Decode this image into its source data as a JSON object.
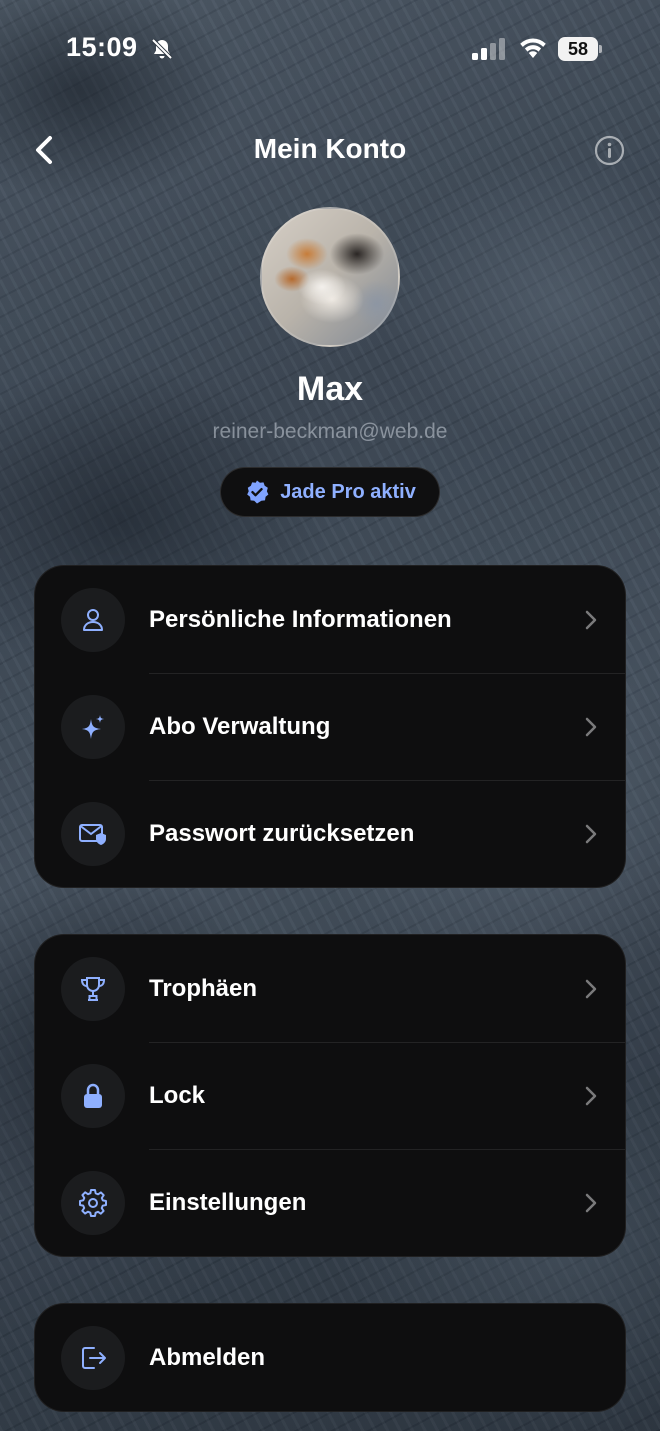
{
  "status_bar": {
    "time": "15:09",
    "battery": "58"
  },
  "nav": {
    "title": "Mein Konto"
  },
  "profile": {
    "name": "Max",
    "email": "reiner-beckman@web.de",
    "badge": "Jade Pro aktiv"
  },
  "colors": {
    "accent": "#8fb0ff",
    "card": "#0e0e0f",
    "icon_bg": "#1b1c1e"
  },
  "groups": [
    {
      "items": [
        {
          "label": "Persönliche Informationen",
          "icon": "person-icon"
        },
        {
          "label": "Abo Verwaltung",
          "icon": "sparkles-icon"
        },
        {
          "label": "Passwort zurücksetzen",
          "icon": "mail-shield-icon"
        }
      ]
    },
    {
      "items": [
        {
          "label": "Trophäen",
          "icon": "trophy-icon"
        },
        {
          "label": "Lock",
          "icon": "lock-icon"
        },
        {
          "label": "Einstellungen",
          "icon": "gear-icon"
        }
      ]
    },
    {
      "items": [
        {
          "label": "Abmelden",
          "icon": "logout-icon"
        }
      ]
    }
  ]
}
